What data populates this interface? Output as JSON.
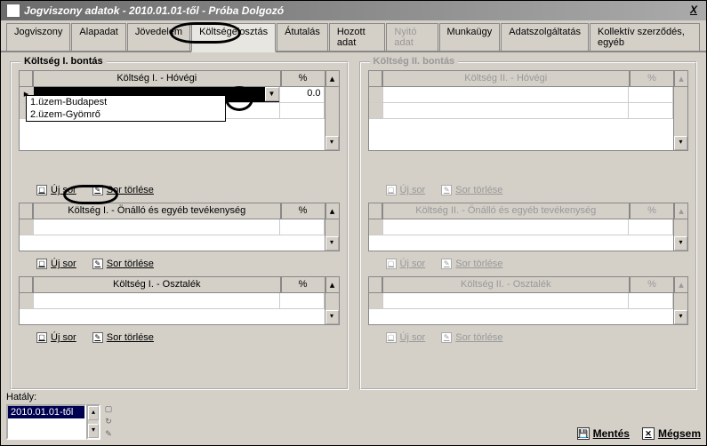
{
  "window": {
    "title": "Jogviszony adatok - 2010.01.01-től - Próba Dolgozó"
  },
  "tabs": [
    {
      "label": "Jogviszony"
    },
    {
      "label": "Alapadat"
    },
    {
      "label": "Jövedelem"
    },
    {
      "label": "Költségelosztás"
    },
    {
      "label": "Átutalás"
    },
    {
      "label": "Hozott adat"
    },
    {
      "label": "Nyitó adat"
    },
    {
      "label": "Munkaügy"
    },
    {
      "label": "Adatszolgáltatás"
    },
    {
      "label": "Kollektív szerződés, egyéb"
    }
  ],
  "left": {
    "title": "Költség I. bontás",
    "g1": {
      "h1": "Költség I. - Hóvégi",
      "h2": "%",
      "val": "0.0"
    },
    "g2": {
      "h1": "Költség I. - Önálló és egyéb tevékenység",
      "h2": "%"
    },
    "g3": {
      "h1": "Költség I. - Osztalék",
      "h2": "%"
    }
  },
  "right": {
    "title": "Költség II. bontás",
    "g1": {
      "h1": "Költség II. - Hóvégi",
      "h2": "%"
    },
    "g2": {
      "h1": "Költség II. - Önálló és egyéb tevékenység",
      "h2": "%"
    },
    "g3": {
      "h1": "Költség II. - Osztalék",
      "h2": "%"
    }
  },
  "dropdown": {
    "options": [
      "1.üzem-Budapest",
      "2.üzem-Gyömrő"
    ]
  },
  "toolbar": {
    "uj": "Új sor",
    "torles": "Sor törlése"
  },
  "hataly": {
    "label": "Hatály:",
    "item": "2010.01.01-től"
  },
  "footer": {
    "mentes": "Mentés",
    "megsem": "Mégsem"
  }
}
